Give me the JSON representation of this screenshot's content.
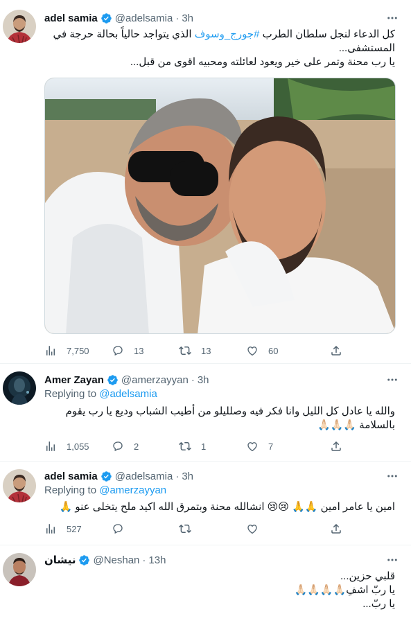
{
  "tweets": [
    {
      "name": "adel samia",
      "handle": "@adelsamia",
      "time": "3h",
      "text_lines": [
        "كل الدعاء لنجل سلطان الطرب",
        "المستشفى...",
        "يا رب محنة وتمر على خير ويعود لعائلته ومحبيه اقوى من قبل..."
      ],
      "hashtag": "#جورج_وسوف",
      "text_rest": "الذي يتواجد حالياً بحالة حرجة في",
      "metrics": {
        "views": "7,750",
        "replies": "13",
        "retweets": "13",
        "likes": "60"
      }
    },
    {
      "name": "Amer Zayan",
      "handle": "@amerzayyan",
      "time": "3h",
      "replying_prefix": "Replying to",
      "replying_to": "@adelsamia",
      "text_lines": [
        "والله يا عادل كل الليل وانا فكر فيه وصلليلو من أطيب الشباب وديع يا رب يقوم",
        "بالسلامة 🙏🏻🙏🏻🙏🏻"
      ],
      "metrics": {
        "views": "1,055",
        "replies": "2",
        "retweets": "1",
        "likes": "7"
      }
    },
    {
      "name": "adel samia",
      "handle": "@adelsamia",
      "time": "3h",
      "replying_prefix": "Replying to",
      "replying_to": "@amerzayyan",
      "text_lines": [
        "امين يا عامر امين 🙏🙏 😢😢 انشالله محنة وبتمرق الله اكيد ملح يتخلى عنو 🙏"
      ],
      "metrics": {
        "views": "527",
        "replies": "",
        "retweets": "",
        "likes": ""
      }
    },
    {
      "name": "نيشان",
      "handle": "@Neshan",
      "time": "13h",
      "text_lines": [
        "قلبي حزين...",
        "يا ربّ اشفِ🙏🏻🙏🏻🙏🏻🙏🏻",
        "يا ربّ..."
      ]
    }
  ],
  "colors": {
    "accent": "#1d9bf0",
    "muted": "#536471",
    "text": "#0f1419"
  }
}
